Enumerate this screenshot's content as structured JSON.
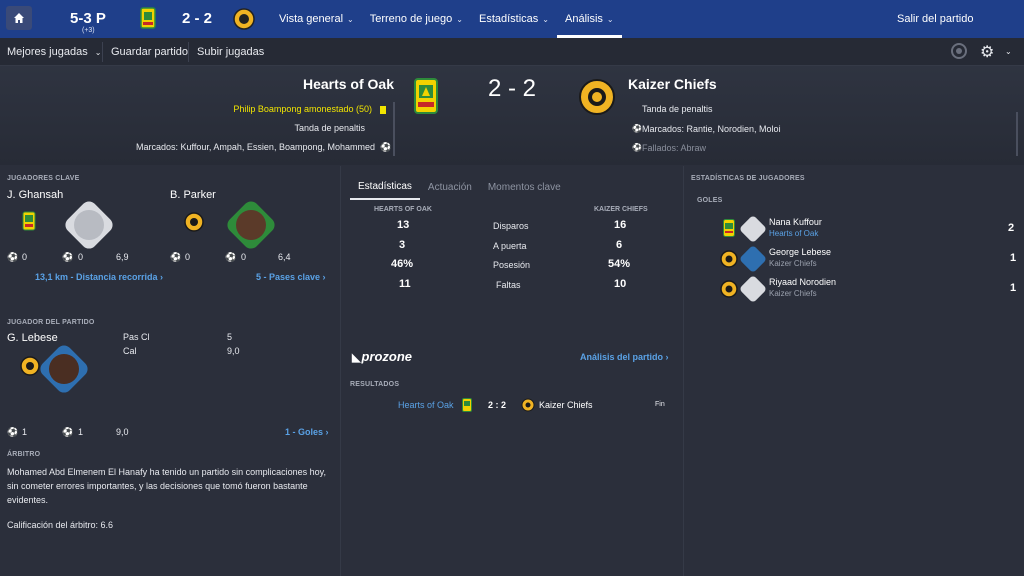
{
  "topbar": {
    "record": "5-3 P",
    "record_sub": "(+3)",
    "score": "2 - 2",
    "nav": [
      {
        "label": "Vista general"
      },
      {
        "label": "Terreno de juego"
      },
      {
        "label": "Estadísticas"
      },
      {
        "label": "Análisis"
      }
    ],
    "exit_label": "Salir del partido"
  },
  "subbar": {
    "items": [
      "Mejores jugadas",
      "Guardar partido",
      "Subir jugadas"
    ]
  },
  "match": {
    "home_team": "Hearts of Oak",
    "away_team": "Kaizer Chiefs",
    "score": "2 - 2",
    "home_events": {
      "booking": "Philip Boampong amonestado (50)",
      "shootout": "Tanda de penaltis",
      "scored": "Marcados: Kuffour, Ampah, Essien, Boampong, Mohammed"
    },
    "away_events": {
      "shootout": "Tanda de penaltis",
      "scored": "Marcados: Rantie, Norodien, Moloi",
      "missed": "Fallados: Abraw"
    }
  },
  "key_players": {
    "section": "JUGADORES CLAVE",
    "home": {
      "name": "J. Ghansah",
      "goals": "0",
      "assists": "0",
      "rating": "6,9",
      "link": "13,1 km - Distancia recorrida ›"
    },
    "away": {
      "name": "B. Parker",
      "goals": "0",
      "assists": "0",
      "rating": "6,4",
      "link": "5 - Pases clave ›"
    }
  },
  "motm": {
    "section": "JUGADOR DEL PARTIDO",
    "name": "G. Lebese",
    "stat1_label": "Pas Cl",
    "stat1_value": "5",
    "stat2_label": "Cal",
    "stat2_value": "9,0",
    "goals": "1",
    "assists": "1",
    "rating": "9,0",
    "link": "1 - Goles ›"
  },
  "referee": {
    "section": "ÁRBITRO",
    "text": "Mohamed Abd Elmenem El Hanafy ha tenido un partido sin complicaciones hoy, sin cometer errores importantes, y las decisiones que tomó fueron bastante evidentes.",
    "rating": "Calificación del árbitro: 6.6"
  },
  "stats": {
    "tabs": [
      "Estadísticas",
      "Actuación",
      "Momentos clave"
    ],
    "home_header": "HEARTS OF OAK",
    "away_header": "KAIZER CHIEFS",
    "rows": [
      {
        "label": "Disparos",
        "home": "13",
        "away": "16"
      },
      {
        "label": "A puerta",
        "home": "3",
        "away": "6"
      },
      {
        "label": "Posesión",
        "home": "46%",
        "away": "54%"
      },
      {
        "label": "Faltas",
        "home": "11",
        "away": "10"
      }
    ]
  },
  "prozone": {
    "logo": "prozone",
    "link": "Análisis del partido ›"
  },
  "results": {
    "section": "RESULTADOS",
    "home": "Hearts of Oak",
    "score": "2 : 2",
    "away": "Kaizer Chiefs",
    "status": "Fin"
  },
  "player_stats": {
    "section": "ESTADÍSTICAS DE JUGADORES",
    "subsection": "GOLES",
    "scorers": [
      {
        "name": "Nana Kuffour",
        "club": "Hearts of Oak",
        "goals": "2"
      },
      {
        "name": "George Lebese",
        "club": "Kaizer Chiefs",
        "goals": "1"
      },
      {
        "name": "Riyaad Norodien",
        "club": "Kaizer Chiefs",
        "goals": "1"
      }
    ]
  },
  "colors": {
    "topbar": "#1f3f8a",
    "background": "#2b2f3b",
    "link": "#5aa2e6",
    "yellow_card": "#f2e500",
    "kaizer_gold": "#f0b323",
    "hearts_green": "#2e8b3a"
  }
}
